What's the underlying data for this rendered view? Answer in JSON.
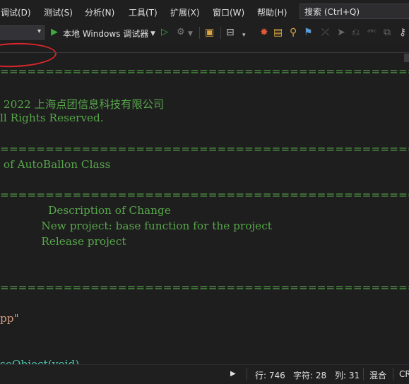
{
  "menu": {
    "items": [
      "调试(D)",
      "测试(S)",
      "分析(N)",
      "工具(T)",
      "扩展(X)",
      "窗口(W)",
      "帮助(H)"
    ],
    "search_placeholder": "搜索 (Ctrl+Q)"
  },
  "toolbar": {
    "debug_target": "本地 Windows 调试器",
    "play_icon": "play-icon",
    "dropdown_chevron": "▾"
  },
  "editor": {
    "lines": [
      "================================================",
      "",
      " 2022 上海点团信息科技有限公司",
      "ll Rights Reserved.",
      "",
      "================================================",
      " of AutoBallon Class",
      "",
      "================================================",
      "              Description of Change",
      "            New project: base function for the project",
      "            Release project",
      "",
      "",
      "==============================================*/",
      "",
      "pp\"",
      "",
      "",
      "seObject(void)"
    ]
  },
  "statusbar": {
    "line": "行: 746",
    "char": "字符: 28",
    "col": "列: 31",
    "mode": "混合",
    "eol": "CR"
  },
  "colors": {
    "comment": "#57a64a",
    "string": "#d69d85",
    "background": "#1e1e1e",
    "highlight_circle": "#d9262c",
    "play_green": "#3aab3a"
  }
}
